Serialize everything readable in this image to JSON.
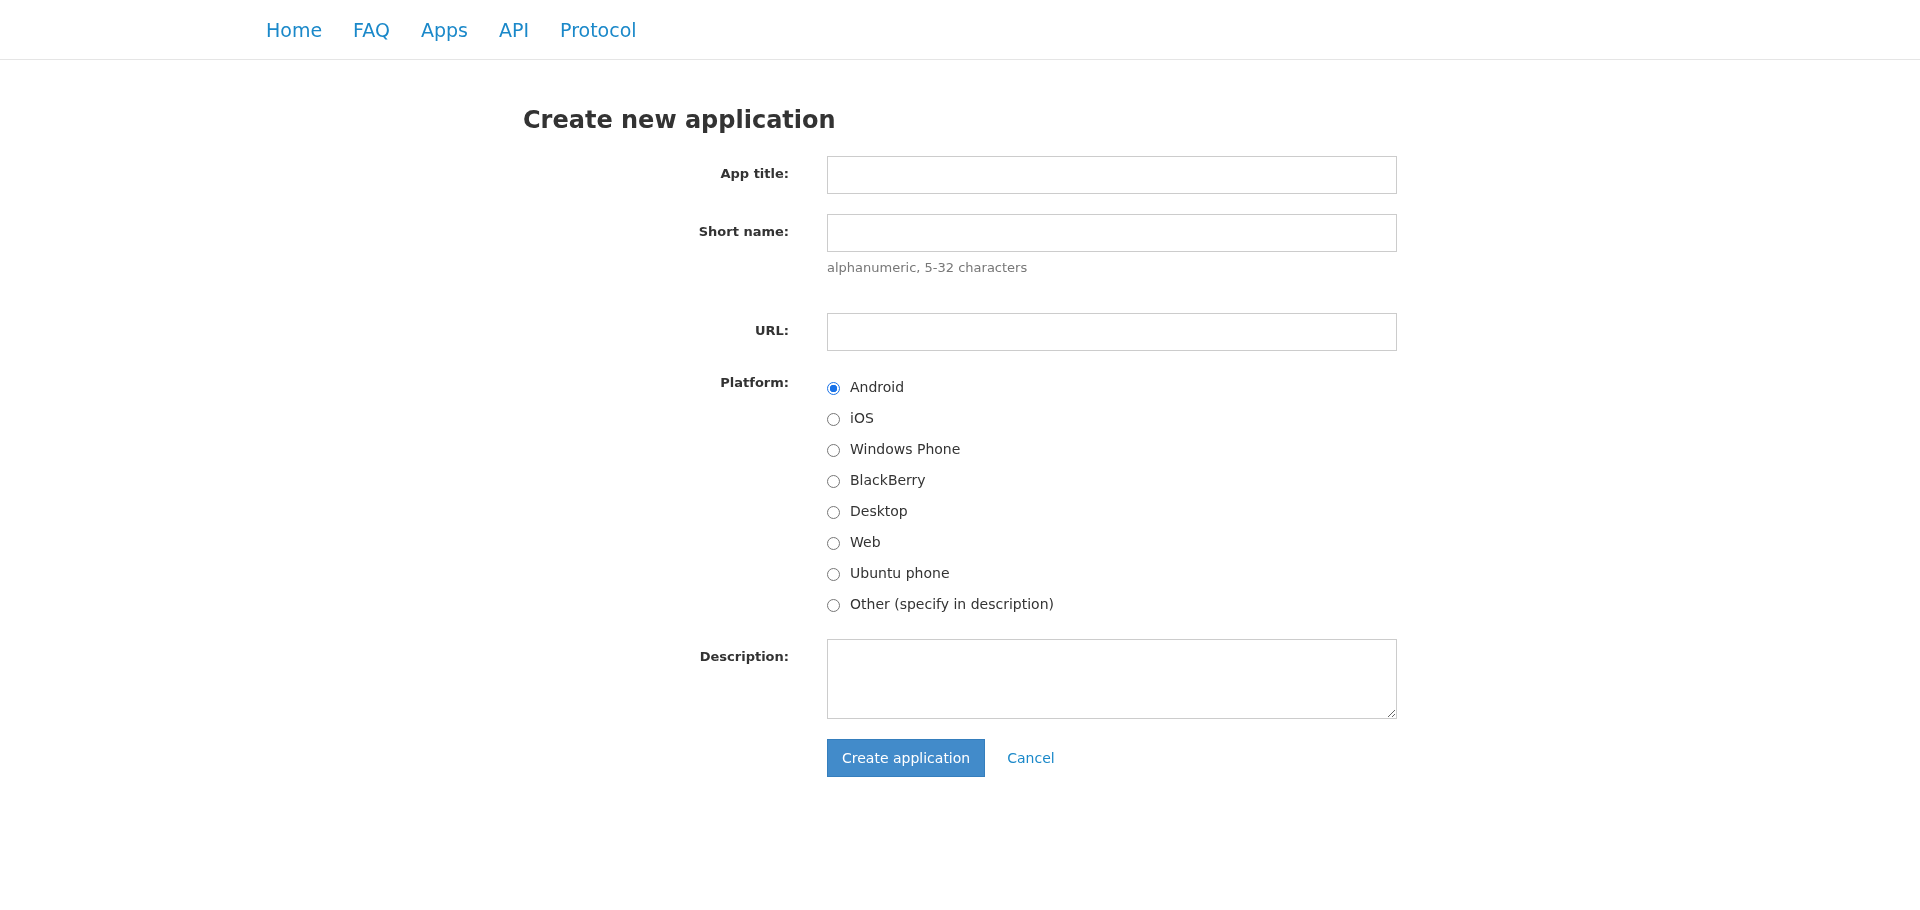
{
  "nav": [
    {
      "label": "Home"
    },
    {
      "label": "FAQ"
    },
    {
      "label": "Apps"
    },
    {
      "label": "API"
    },
    {
      "label": "Protocol"
    }
  ],
  "title": "Create new application",
  "fields": [
    {
      "kind": "text",
      "label": "App title:"
    },
    {
      "kind": "text",
      "label": "Short name:",
      "hint": "alphanumeric, 5-32 characters"
    },
    {
      "kind": "text",
      "label": "URL:"
    },
    {
      "kind": "radio",
      "label": "Platform:",
      "options": [
        {
          "label": "Android",
          "selected": true
        },
        {
          "label": "iOS",
          "selected": false
        },
        {
          "label": "Windows Phone",
          "selected": false
        },
        {
          "label": "BlackBerry",
          "selected": false
        },
        {
          "label": "Desktop",
          "selected": false
        },
        {
          "label": "Web",
          "selected": false
        },
        {
          "label": "Ubuntu phone",
          "selected": false
        },
        {
          "label": "Other (specify in description)",
          "selected": false
        }
      ]
    },
    {
      "kind": "textarea",
      "label": "Description:"
    }
  ],
  "actions": [
    {
      "kind": "primary",
      "label": "Create application"
    },
    {
      "kind": "link",
      "label": "Cancel"
    }
  ]
}
